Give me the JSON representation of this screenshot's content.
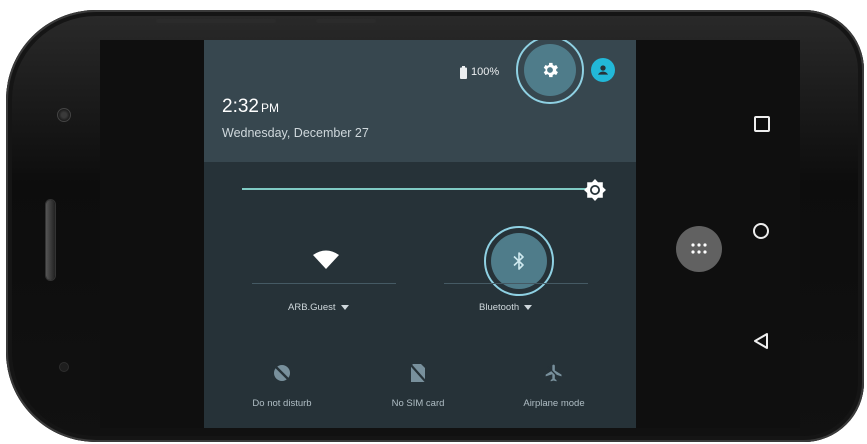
{
  "status_bar": {
    "battery_text": "100%"
  },
  "header": {
    "time": "2:32",
    "ampm": "PM",
    "date": "Wednesday, December 27"
  },
  "tiles": {
    "wifi_label": "ARB.Guest",
    "bluetooth_label": "Bluetooth",
    "do_not_disturb_label": "Do not disturb",
    "sim_label": "No SIM card",
    "airplane_label": "Airplane mode"
  },
  "colors": {
    "panel_background": "#263238",
    "header_background": "#37474f",
    "highlight_ring": "#8fd1e3",
    "active_tile": "#4f7c8a",
    "accent": "#22b8d8",
    "slider": "#80cbc4"
  },
  "brightness_level": 0.98,
  "icons": {
    "settings": "gear-icon",
    "user": "user-icon",
    "battery": "battery-icon",
    "wifi": "wifi-icon",
    "bluetooth": "bluetooth-icon",
    "do_not_disturb": "do-not-disturb-icon",
    "sim": "no-sim-icon",
    "airplane": "airplane-icon",
    "apps": "app-drawer-icon"
  }
}
